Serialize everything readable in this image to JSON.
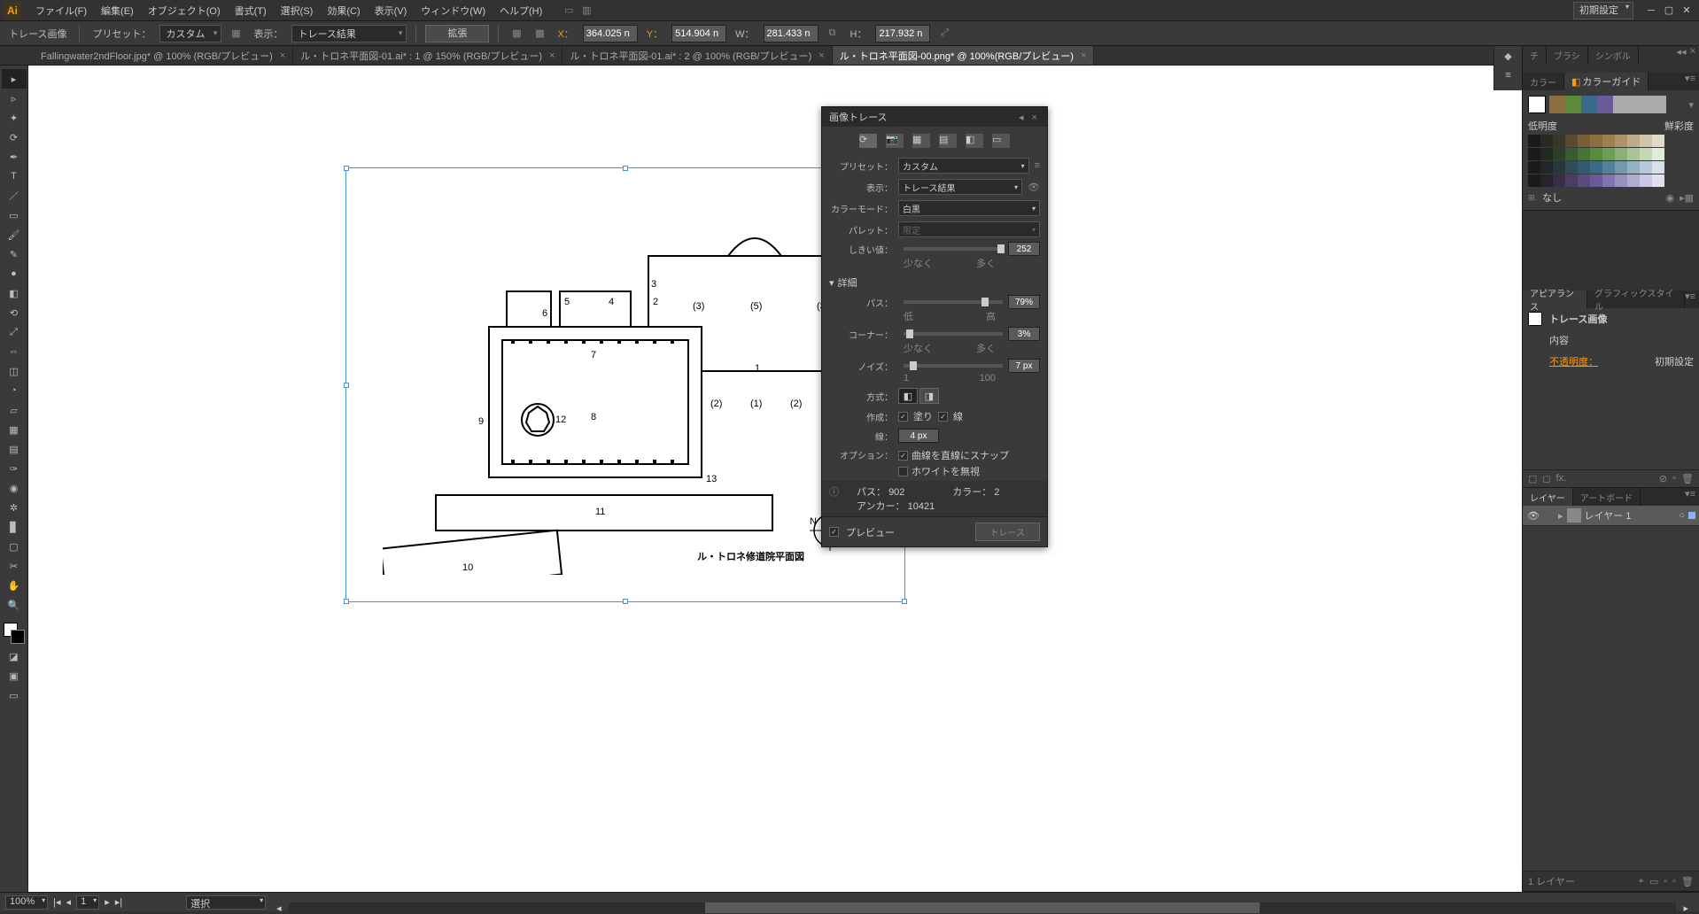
{
  "menubar": {
    "items": [
      "ファイル(F)",
      "編集(E)",
      "オブジェクト(O)",
      "書式(T)",
      "選択(S)",
      "効果(C)",
      "表示(V)",
      "ウィンドウ(W)",
      "ヘルプ(H)"
    ]
  },
  "workspace": {
    "label": "初期設定"
  },
  "controlbar": {
    "object_type": "トレース画像",
    "preset_label": "プリセット：",
    "preset_value": "カスタム",
    "view_label": "表示：",
    "view_value": "トレース結果",
    "expand_btn": "拡張",
    "x_label": "X：",
    "x_value": "364.025 n",
    "y_label": "Y：",
    "y_value": "514.904 n",
    "w_label": "W：",
    "w_value": "281.433 n",
    "h_label": "H：",
    "h_value": "217.932 n"
  },
  "tabs": [
    {
      "label": "Fallingwater2ndFloor.jpg* @ 100% (RGB/プレビュー)",
      "active": false
    },
    {
      "label": "ル・トロネ平面図-01.ai* : 1 @ 150% (RGB/プレビュー)",
      "active": false
    },
    {
      "label": "ル・トロネ平面図-01.ai* : 2 @ 100% (RGB/プレビュー)",
      "active": false
    },
    {
      "label": "ル・トロネ平面図-00.png* @ 100%(RGB/プレビュー)",
      "active": true
    }
  ],
  "artwork": {
    "caption": "ル・トロネ修道院平面図",
    "compass_n": "N"
  },
  "trace_panel": {
    "title": "画像トレース",
    "preset_label": "プリセット：",
    "preset_value": "カスタム",
    "view_label": "表示：",
    "view_value": "トレース結果",
    "mode_label": "カラーモード：",
    "mode_value": "白黒",
    "palette_label": "パレット：",
    "palette_value": "限定",
    "threshold_label": "しきい値：",
    "threshold_value": "252",
    "threshold_min": "少なく",
    "threshold_max": "多く",
    "detail_header": "詳細",
    "paths_label": "パス：",
    "paths_value": "79%",
    "paths_min": "低",
    "paths_max": "高",
    "corners_label": "コーナー：",
    "corners_value": "3%",
    "corners_min": "少なく",
    "corners_max": "多く",
    "noise_label": "ノイズ：",
    "noise_value": "7 px",
    "noise_min": "1",
    "noise_max": "100",
    "method_label": "方式：",
    "create_label": "作成：",
    "create_fill": "塗り",
    "create_stroke": "線",
    "stroke_label": "線：",
    "stroke_value": "4 px",
    "options_label": "オプション：",
    "option_snap": "曲線を直線にスナップ",
    "option_ignore_white": "ホワイトを無視",
    "info_paths_label": "パス：",
    "info_paths_value": "902",
    "info_colors_label": "カラー：",
    "info_colors_value": "2",
    "info_anchors_label": "アンカー：",
    "info_anchors_value": "10421",
    "preview_label": "プレビュー",
    "trace_btn": "トレース"
  },
  "right_panels": {
    "tabs_row1": [
      "チ",
      "ブラシ",
      "シンボル"
    ],
    "color_tab": "カラー",
    "colorguide_tab": "カラーガイド",
    "lowlight": "低明度",
    "vivid": "鮮彩度",
    "none_label": "なし",
    "appearance_tab": "アピアランス",
    "graphic_tab": "グラフィックスタイル",
    "appearance_title": "トレース画像",
    "appearance_content": "内容",
    "opacity_label": "不透明度：",
    "opacity_value": "初期設定",
    "layers_tab": "レイヤー",
    "artboards_tab": "アートボード",
    "layer1_name": "レイヤー 1",
    "layer_count": "1 レイヤー"
  },
  "statusbar": {
    "zoom": "100%",
    "page": "1",
    "tool": "選択"
  }
}
